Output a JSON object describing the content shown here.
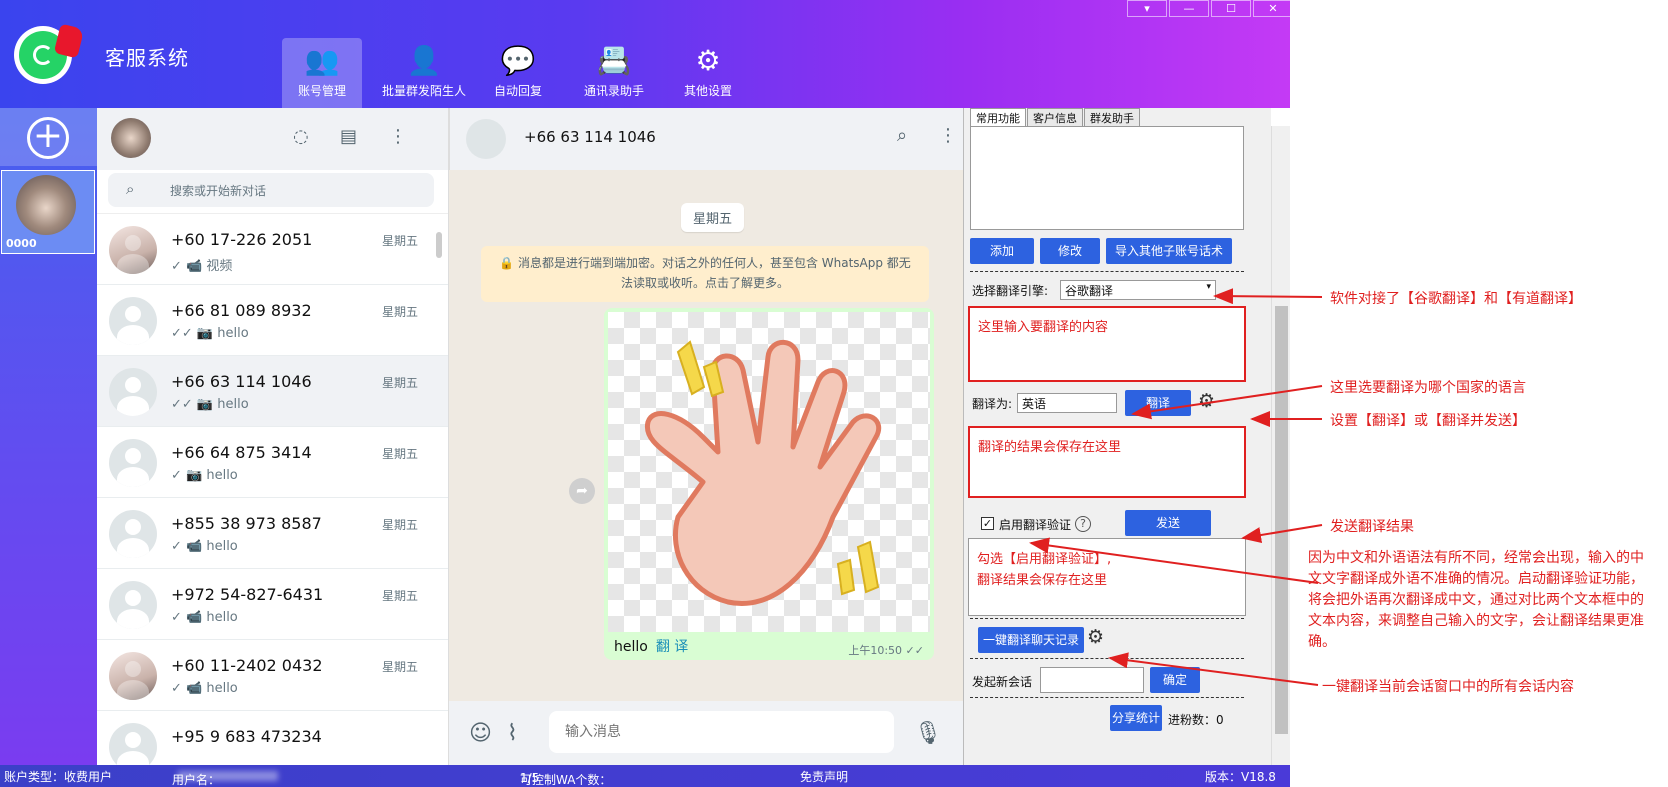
{
  "app": {
    "title": "客服系统"
  },
  "nav": [
    {
      "label": "账号管理",
      "icon": "users-icon",
      "active": true
    },
    {
      "label": "批量群发陌生人",
      "icon": "broadcast-icon"
    },
    {
      "label": "自动回复",
      "icon": "chat-bubble-icon"
    },
    {
      "label": "通讯录助手",
      "icon": "contacts-icon"
    },
    {
      "label": "其他设置",
      "icon": "gear-icon"
    }
  ],
  "account": {
    "label": "0000"
  },
  "search": {
    "placeholder": "搜索或开始新对话"
  },
  "chats": [
    {
      "name": "+60 17-226 2051",
      "time": "星期五",
      "last": "✓ 📹 视频",
      "photo": true
    },
    {
      "name": "+66 81 089 8932",
      "time": "星期五",
      "last": "✓✓ 📷 hello"
    },
    {
      "name": "+66 63 114 1046",
      "time": "星期五",
      "last": "✓✓ 📷 hello",
      "selected": true
    },
    {
      "name": "+66 64 875 3414",
      "time": "星期五",
      "last": "✓ 📷 hello"
    },
    {
      "name": "+855 38 973 8587",
      "time": "星期五",
      "last": "✓ 📹 hello"
    },
    {
      "name": "+972 54-827-6431",
      "time": "星期五",
      "last": "✓ 📹 hello"
    },
    {
      "name": "+60 11-2402 0432",
      "time": "星期五",
      "last": "✓ 📹 hello",
      "photo": true
    },
    {
      "name": "+95 9 683 473234",
      "time": "",
      "last": ""
    }
  ],
  "conversation": {
    "contact": "+66 63 114 1046",
    "day": "星期五",
    "encryption": "🔒 消息都是进行端到端加密。对话之外的任何人，甚至包含 WhatsApp 都无法读取或收听。点击了解更多。",
    "message_text": "hello",
    "translate_link": "翻 译",
    "message_time": "上午10:50 ✓✓",
    "input_placeholder": "输入消息"
  },
  "panel": {
    "tabs": [
      "常用功能",
      "客户信息",
      "群发助手"
    ],
    "add_label": "添加",
    "edit_label": "修改",
    "import_label": "导入其他子账号话术",
    "engine_label": "选择翻译引擎:",
    "engine_value": "谷歌翻译",
    "source_text": "这里输入要翻译的内容",
    "target_label": "翻译为:",
    "target_value": "英语",
    "translate_btn": "翻译",
    "result_text": "翻译的结果会保存在这里",
    "verify_label": "启用翻译验证",
    "send_btn": "发送",
    "verify_text_1": "勾选【启用翻译验证】,",
    "verify_text_2": "翻译结果会保存在这里",
    "translate_all_btn": "一键翻译聊天记录",
    "new_chat_label": "发起新会话",
    "confirm_btn": "确定",
    "share_btn": "分享统计",
    "fans_label": "进粉数：",
    "fans_value": "0"
  },
  "status": {
    "account_type": "账户类型：收费用户",
    "username_label": "用户名：",
    "control_label": "可控制WA个数：",
    "control_value": "1/5",
    "disclaimer": "免责声明",
    "version": "版本：V18.8"
  },
  "annotations": {
    "engine": "软件对接了【谷歌翻译】和【有道翻译】",
    "language": "这里选要翻译为哪个国家的语言",
    "settings": "设置【翻译】或【翻译并发送】",
    "send": "发送翻译结果",
    "verify": "因为中文和外语语法有所不同，经常会出现，输入的中文文字翻译成外语不准确的情况。启动翻译验证功能，将会把外语再次翻译成中文，通过对比两个文本框中的文本内容，来调整自己输入的文字，会让翻译结果更准确。",
    "translate_all": "一键翻译当前会话窗口中的所有会话内容"
  },
  "colors": {
    "accent": "#2d62e0",
    "annotation": "#e02020",
    "bubble": "#d9fdd3",
    "header_start": "#3a44ee",
    "header_end": "#c43af5"
  }
}
